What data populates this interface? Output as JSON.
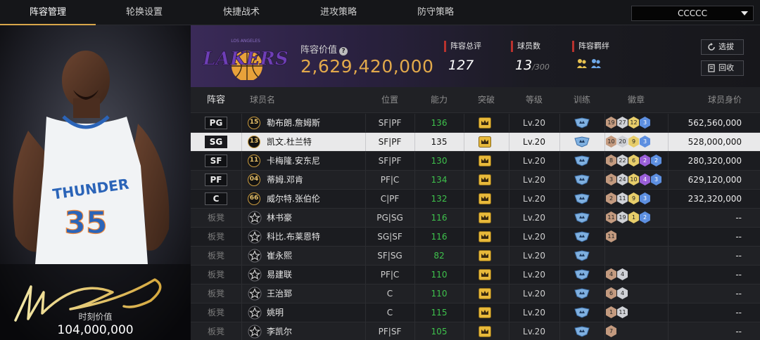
{
  "tabs": [
    {
      "label": "阵容管理",
      "active": true
    },
    {
      "label": "轮换设置",
      "active": false
    },
    {
      "label": "快捷战术",
      "active": false
    },
    {
      "label": "进攻策略",
      "active": false
    },
    {
      "label": "防守策略",
      "active": false
    }
  ],
  "team_selector": {
    "value": "CCCCC"
  },
  "player_card": {
    "jersey_number": "35",
    "jersey_team": "THUNDER",
    "value_label": "时刻价值",
    "value": "104,000,000"
  },
  "summary": {
    "logo_text": "LAKERS",
    "logo_subtext": "LOS ANGELES",
    "lineup_value_label": "阵容价值",
    "lineup_value": "2,629,420,000",
    "total_rating_label": "阵容总评",
    "total_rating": "127",
    "player_count_label": "球员数",
    "player_count": "13",
    "player_count_max": "/300",
    "bond_label": "阵容羁绊",
    "select_button": "选拔",
    "recycle_button": "回收"
  },
  "table": {
    "headers": [
      "阵容",
      "球员名",
      "位置",
      "能力",
      "突破",
      "等级",
      "训练",
      "徽章",
      "球员身价"
    ],
    "rows": [
      {
        "slot": "PG",
        "starter": true,
        "number": "15",
        "name": "勒布朗.詹姆斯",
        "position": "SF|PF",
        "ability": "136",
        "level": "Lv.20",
        "badges": [
          [
            "19",
            "bronze"
          ],
          [
            "27",
            "silver"
          ],
          [
            "12",
            "gold"
          ],
          [
            "3",
            "blue"
          ]
        ],
        "value": "562,560,000"
      },
      {
        "slot": "SG",
        "starter": true,
        "number": "13",
        "name": "凯文.杜兰特",
        "position": "SF|PF",
        "ability": "135",
        "level": "Lv.20",
        "badges": [
          [
            "10",
            "bronze"
          ],
          [
            "20",
            "silver"
          ],
          [
            "9",
            "gold"
          ],
          [
            "3",
            "blue"
          ]
        ],
        "value": "528,000,000",
        "selected": true
      },
      {
        "slot": "SF",
        "starter": true,
        "number": "11",
        "name": "卡梅隆.安东尼",
        "position": "SF|PF",
        "ability": "130",
        "level": "Lv.20",
        "badges": [
          [
            "8",
            "bronze"
          ],
          [
            "22",
            "silver"
          ],
          [
            "6",
            "gold"
          ],
          [
            "2",
            "purple"
          ],
          [
            "2",
            "blue"
          ]
        ],
        "value": "280,320,000"
      },
      {
        "slot": "PF",
        "starter": true,
        "number": "04",
        "name": "蒂姆.邓肯",
        "position": "PF|C",
        "ability": "134",
        "level": "Lv.20",
        "badges": [
          [
            "3",
            "bronze"
          ],
          [
            "24",
            "silver"
          ],
          [
            "10",
            "gold"
          ],
          [
            "4",
            "purple"
          ],
          [
            "3",
            "blue"
          ]
        ],
        "value": "629,120,000"
      },
      {
        "slot": "C",
        "starter": true,
        "number": "66",
        "name": "威尔特.张伯伦",
        "position": "C|PF",
        "ability": "132",
        "level": "Lv.20",
        "badges": [
          [
            "2",
            "bronze"
          ],
          [
            "11",
            "silver"
          ],
          [
            "9",
            "gold"
          ],
          [
            "3",
            "blue"
          ]
        ],
        "value": "232,320,000"
      },
      {
        "slot": "板凳",
        "starter": false,
        "number": "",
        "name": "林书豪",
        "position": "PG|SG",
        "ability": "116",
        "level": "Lv.20",
        "badges": [
          [
            "11",
            "bronze"
          ],
          [
            "19",
            "silver"
          ],
          [
            "1",
            "gold"
          ],
          [
            "2",
            "blue"
          ]
        ],
        "value": "--"
      },
      {
        "slot": "板凳",
        "starter": false,
        "number": "",
        "name": "科比.布莱恩特",
        "position": "SG|SF",
        "ability": "116",
        "level": "Lv.20",
        "badges": [
          [
            "11",
            "bronze"
          ]
        ],
        "value": "--"
      },
      {
        "slot": "板凳",
        "starter": false,
        "number": "",
        "name": "崔永熙",
        "position": "SF|SG",
        "ability": "82",
        "level": "Lv.20",
        "badges": [],
        "value": "--"
      },
      {
        "slot": "板凳",
        "starter": false,
        "number": "",
        "name": "易建联",
        "position": "PF|C",
        "ability": "110",
        "level": "Lv.20",
        "badges": [
          [
            "4",
            "bronze"
          ],
          [
            "4",
            "silver"
          ]
        ],
        "value": "--"
      },
      {
        "slot": "板凳",
        "starter": false,
        "number": "",
        "name": "王治郅",
        "position": "C",
        "ability": "110",
        "level": "Lv.20",
        "badges": [
          [
            "6",
            "bronze"
          ],
          [
            "4",
            "silver"
          ]
        ],
        "value": "--"
      },
      {
        "slot": "板凳",
        "starter": false,
        "number": "",
        "name": "姚明",
        "position": "C",
        "ability": "115",
        "level": "Lv.20",
        "badges": [
          [
            "1",
            "bronze"
          ],
          [
            "11",
            "silver"
          ]
        ],
        "value": "--"
      },
      {
        "slot": "板凳",
        "starter": false,
        "number": "",
        "name": "李凯尔",
        "position": "PF|SF",
        "ability": "105",
        "level": "Lv.20",
        "badges": [
          [
            "7",
            "bronze"
          ]
        ],
        "value": "--"
      }
    ]
  },
  "icons": {
    "help": "help-icon",
    "refresh": "refresh-icon",
    "recycle": "recycle-icon",
    "breakthrough": "crown-badge-icon",
    "training": "training-shield-icon",
    "bench_slot": "star-icon"
  },
  "colors": {
    "accent_gold": "#d8a64a",
    "value_gold": "#e2a94b",
    "ability_green": "#3ec24c",
    "label_red": "#b8322e",
    "lakers_purple": "#552583"
  }
}
